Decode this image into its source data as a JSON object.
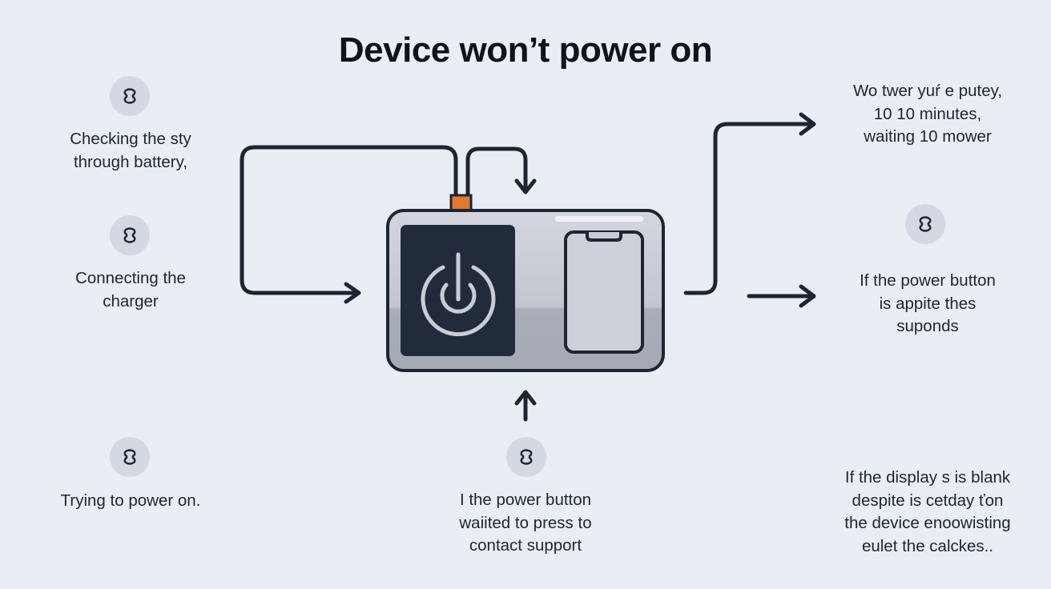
{
  "title": "Device won’t power on",
  "colors": {
    "background": "#e9edf4",
    "ink": "#1d2533",
    "device_body": "#c6c9d2",
    "screen_dark": "#222b3c",
    "accent_connector": "#e07a34",
    "badge": "#d3d8e2"
  },
  "icons": {
    "badge_icon": "link-loop-icon",
    "device_icon": "power-symbol-icon",
    "phone_icon": "phone-outline-icon"
  },
  "left_steps": [
    {
      "lines": [
        "Checking the sty",
        "through battery,"
      ]
    },
    {
      "lines": [
        "Connecting the",
        "charger"
      ]
    },
    {
      "lines": [
        "Trying to power on."
      ]
    }
  ],
  "center_step": {
    "lines": [
      "I the power button",
      "waiited to press to",
      "contact support"
    ]
  },
  "right_steps": [
    {
      "lines": [
        "Wo twer yuŕ e putey,",
        "10 10 minutes,",
        "waiting 10 mower"
      ]
    },
    {
      "lines": [
        "If the power button",
        "is appite thes",
        "suponds"
      ]
    },
    {
      "lines": [
        "If the display s is blank",
        "despite is cetday ťon",
        "the device enoowisting",
        "eulet the calckes.."
      ]
    }
  ]
}
